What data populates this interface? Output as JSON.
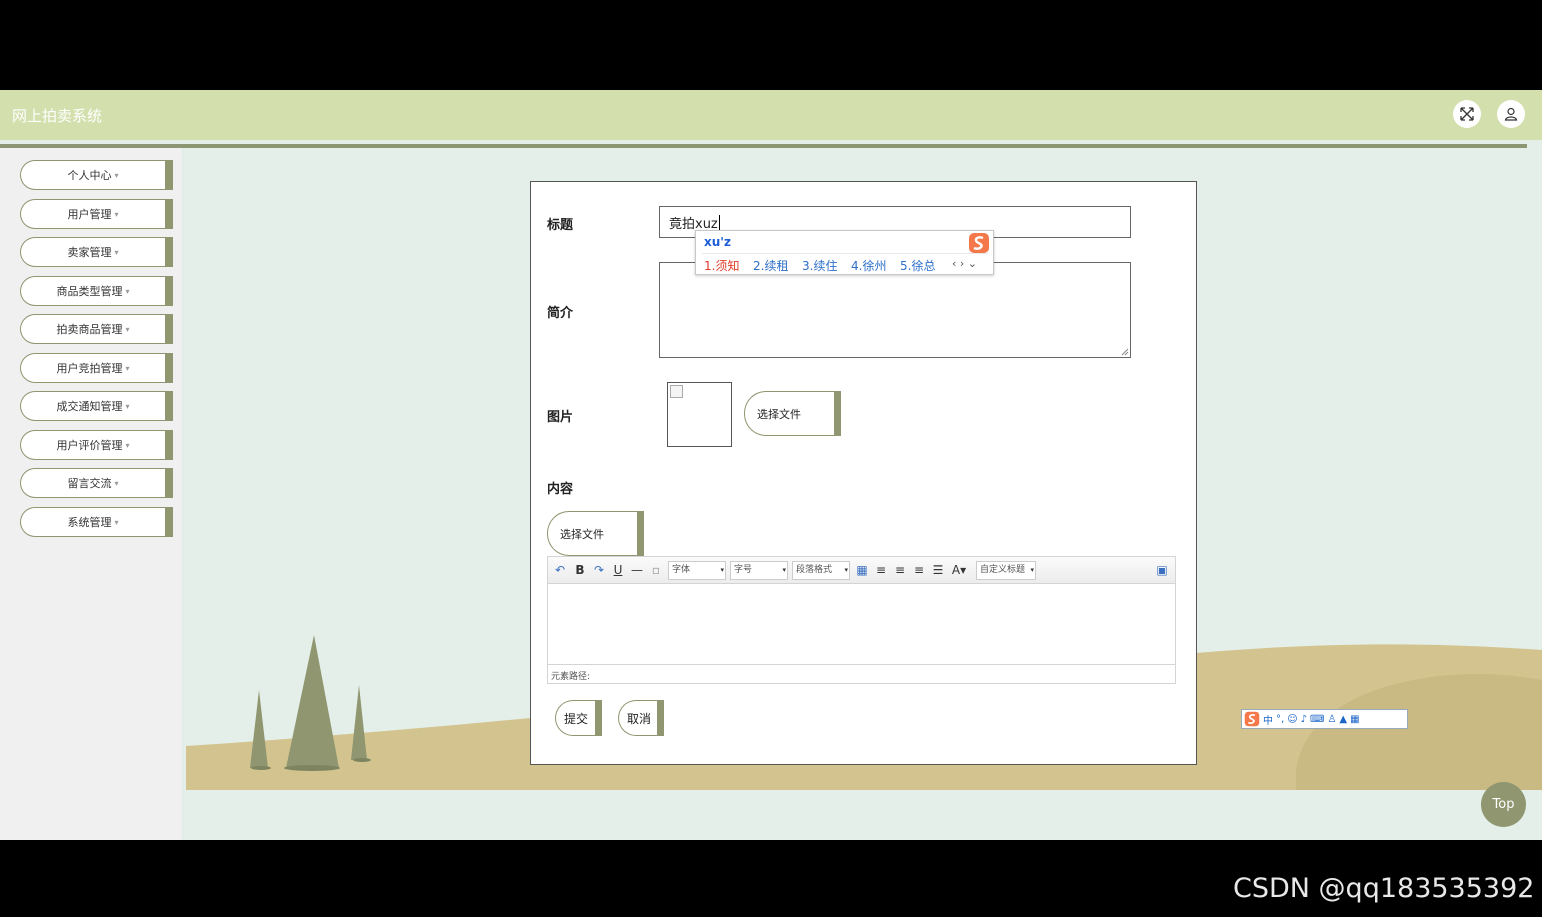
{
  "app": {
    "title": "网上拍卖系统"
  },
  "header_icons": [
    "fullscreen-icon",
    "user-icon"
  ],
  "sidebar": {
    "items": [
      {
        "label": "个人中心"
      },
      {
        "label": "用户管理"
      },
      {
        "label": "卖家管理"
      },
      {
        "label": "商品类型管理"
      },
      {
        "label": "拍卖商品管理"
      },
      {
        "label": "用户竞拍管理"
      },
      {
        "label": "成交通知管理"
      },
      {
        "label": "用户评价管理"
      },
      {
        "label": "留言交流"
      },
      {
        "label": "系统管理"
      }
    ],
    "caret": "▾"
  },
  "form": {
    "title_label": "标题",
    "title_value": "竟拍xuz",
    "intro_label": "简介",
    "image_label": "图片",
    "choose_file_label": "选择文件",
    "content_label": "内容",
    "content_choose_file_label": "选择文件",
    "submit_label": "提交",
    "cancel_label": "取消"
  },
  "editor": {
    "font_family_placeholder": "字体",
    "font_size_placeholder": "字号",
    "paragraph_placeholder": "段落格式",
    "custom_title_placeholder": "自定义标题",
    "element_path_label": "元素路径:",
    "toolbar_icons": [
      "undo-icon",
      "bold-icon",
      "redo-icon",
      "underline-icon",
      "horizontal-rule-icon",
      "clear-icon",
      "table-icon",
      "align-left-icon",
      "align-center-icon",
      "align-right-icon",
      "justify-icon",
      "font-color-icon",
      "fullscreen-icon"
    ]
  },
  "ime": {
    "pinyin": "xu'z",
    "candidates": [
      "1.须知",
      "2.续租",
      "3.续住",
      "4.徐州",
      "5.徐总"
    ],
    "status_bar_label": "中"
  },
  "top_button": "Top",
  "watermark": "CSDN @qq183535392",
  "colors": {
    "header_bg": "#d3dfac",
    "accent": "#8f9670",
    "content_bg": "#e4efe9",
    "hill": "#d3c48f",
    "hill_dark": "#c5b57e"
  }
}
